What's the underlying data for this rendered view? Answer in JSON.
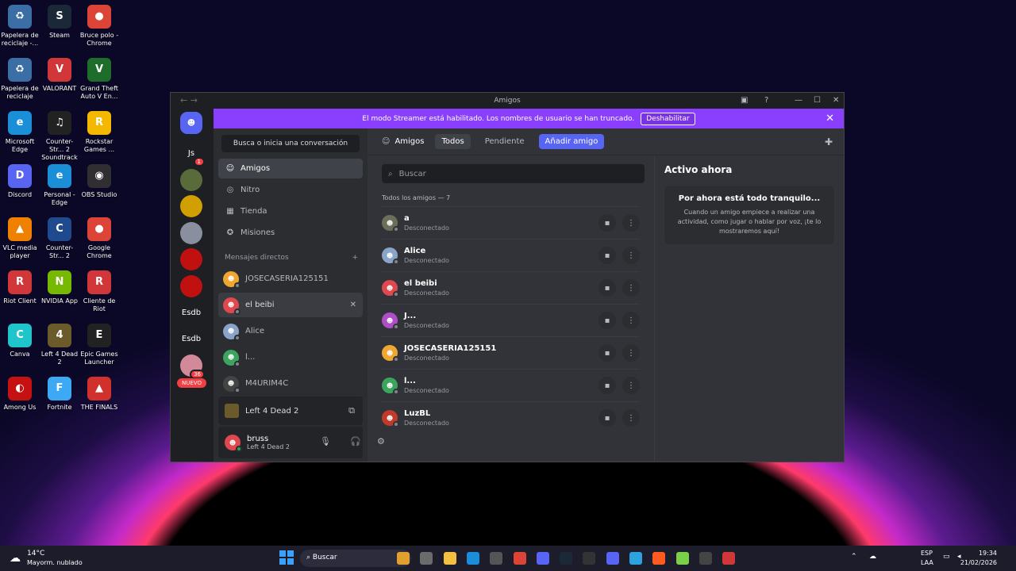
{
  "desktop": [
    {
      "label": "Papelera de reciclaje -...",
      "color": "#3a6ea5",
      "glyph": "♻"
    },
    {
      "label": "Steam",
      "color": "#1b2838",
      "glyph": "S"
    },
    {
      "label": "Bruce polo - Chrome",
      "color": "#db4437",
      "glyph": "●"
    },
    {
      "label": "Papelera de reciclaje",
      "color": "#3a6ea5",
      "glyph": "♻"
    },
    {
      "label": "VALORANT",
      "color": "#d13639",
      "glyph": "V"
    },
    {
      "label": "Grand Theft Auto V En...",
      "color": "#1f6d2a",
      "glyph": "V"
    },
    {
      "label": "Microsoft Edge",
      "color": "#1a8fd8",
      "glyph": "e"
    },
    {
      "label": "Counter-Str... 2 Soundtrack",
      "color": "#222",
      "glyph": "♫"
    },
    {
      "label": "Rockstar Games ...",
      "color": "#f5b800",
      "glyph": "R"
    },
    {
      "label": "Discord",
      "color": "#5865f2",
      "glyph": "D"
    },
    {
      "label": "Personal - Edge",
      "color": "#1a8fd8",
      "glyph": "e"
    },
    {
      "label": "OBS Studio",
      "color": "#302e31",
      "glyph": "◉"
    },
    {
      "label": "VLC media player",
      "color": "#f08000",
      "glyph": "▲"
    },
    {
      "label": "Counter-Str... 2",
      "color": "#1f4b8e",
      "glyph": "C"
    },
    {
      "label": "Google Chrome",
      "color": "#db4437",
      "glyph": "●"
    },
    {
      "label": "Riot Client",
      "color": "#d13639",
      "glyph": "R"
    },
    {
      "label": "NVIDIA App",
      "color": "#76b900",
      "glyph": "N"
    },
    {
      "label": "Cliente de Riot",
      "color": "#d13639",
      "glyph": "R"
    },
    {
      "label": "Canva",
      "color": "#20c4cb",
      "glyph": "C"
    },
    {
      "label": "Left 4 Dead 2",
      "color": "#6b5a2a",
      "glyph": "4"
    },
    {
      "label": "Epic Games Launcher",
      "color": "#222",
      "glyph": "E"
    },
    {
      "label": "Among Us",
      "color": "#c51111",
      "glyph": "◐"
    },
    {
      "label": "Fortnite",
      "color": "#3da9f5",
      "glyph": "F"
    },
    {
      "label": "THE FINALS",
      "color": "#d0312d",
      "glyph": "▲"
    }
  ],
  "window": {
    "title": "Amigos"
  },
  "servers": [
    {
      "label": "Js",
      "color": "#1e1f22",
      "badge": "1"
    },
    {
      "label": "",
      "color": "#5a6b3a",
      "badge": ""
    },
    {
      "label": "",
      "color": "#d1a000",
      "badge": ""
    },
    {
      "label": "",
      "color": "#8a8fa0",
      "badge": ""
    },
    {
      "label": "",
      "color": "#c01010",
      "badge": ""
    },
    {
      "label": "",
      "color": "#c01010",
      "badge": ""
    },
    {
      "label": "Esdb",
      "color": "#1e1f22",
      "badge": ""
    },
    {
      "label": "Esdb",
      "color": "#1e1f22",
      "badge": ""
    },
    {
      "label": "",
      "color": "#d28a9a",
      "badge": "36"
    }
  ],
  "new_badge": "NUEVO",
  "banner": {
    "text": "El modo Streamer está habilitado. Los nombres de usuario se han truncado.",
    "button": "Deshabilitar",
    "close": "✕"
  },
  "dm_search": "Busca o inicia una conversación",
  "nav": [
    {
      "label": "Amigos",
      "icon": "☺"
    },
    {
      "label": "Nitro",
      "icon": "◎"
    },
    {
      "label": "Tienda",
      "icon": "▦"
    },
    {
      "label": "Misiones",
      "icon": "✪"
    }
  ],
  "dm_header": "Mensajes directos",
  "dm_add": "+",
  "dms": [
    {
      "name": "JOSECASERIA125151",
      "color": "#f0a732"
    },
    {
      "name": "el beibi",
      "color": "#e0484f"
    },
    {
      "name": "Alice",
      "color": "#8aa4c8"
    },
    {
      "name": "l...",
      "color": "#3ba55d"
    },
    {
      "name": "M4URIM4C",
      "color": "#444"
    }
  ],
  "game_activity": "Left 4 Dead 2",
  "user": {
    "name": "bruss",
    "status": "Left 4 Dead 2"
  },
  "topbar": {
    "title": "Amigos",
    "tabs": [
      "Todos",
      "Pendiente"
    ],
    "add": "Añadir amigo"
  },
  "friends_search": "Buscar",
  "friends_count": "Todos los amigos — 7",
  "friends": [
    {
      "name": "a",
      "status": "Desconectado",
      "color": "#6b6f5a"
    },
    {
      "name": "Alice",
      "status": "Desconectado",
      "color": "#8aa4c8"
    },
    {
      "name": "el beibi",
      "status": "Desconectado",
      "color": "#e0484f"
    },
    {
      "name": "J...",
      "status": "Desconectado",
      "color": "#b04ec8"
    },
    {
      "name": "JOSECASERIA125151",
      "status": "Desconectado",
      "color": "#f0a732"
    },
    {
      "name": "l...",
      "status": "Desconectado",
      "color": "#3ba55d"
    },
    {
      "name": "LuzBL",
      "status": "Desconectado",
      "color": "#c0392b"
    }
  ],
  "active_now": {
    "title": "Activo ahora",
    "card_title": "Por ahora está todo tranquilo...",
    "card_text": "Cuando un amigo empiece a realizar una actividad, como jugar o hablar por voz, ¡te lo mostraremos aquí!"
  },
  "taskbar": {
    "weather_temp": "14°C",
    "weather_desc": "Mayorm. nublado",
    "search": "Buscar",
    "lang1": "ESP",
    "lang2": "LAA",
    "time": "19:34",
    "date": "21/02/2026"
  }
}
